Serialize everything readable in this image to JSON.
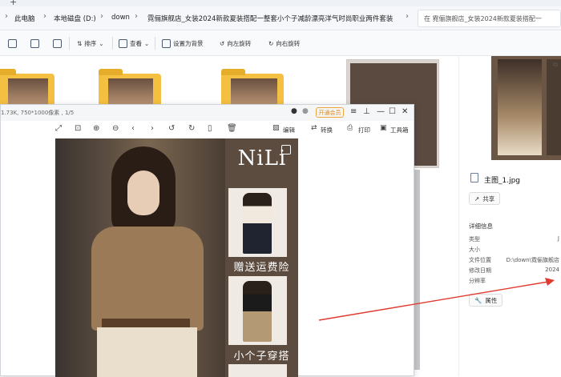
{
  "titlebar": {
    "new_tab": "+"
  },
  "breadcrumb": [
    "此电脑",
    "本地磁盘 (D:)",
    "down",
    "霓俪旗舰店_女装2024新款夏装搭配一整套小个子减龄漂亮洋气时尚职业两件套装"
  ],
  "search": {
    "placeholder": "在 霓俪旗舰店_女装2024新款夏装搭配一"
  },
  "toolbar": {
    "sort": "排序",
    "view": "查看",
    "set_wallpaper": "设置为背景",
    "rotate_left": "向左旋转",
    "rotate_right": "向右旋转"
  },
  "details": {
    "filename": "主图_1.jpg",
    "share": "共享",
    "section": "详细信息",
    "rows": [
      {
        "key": "类型",
        "value": "J"
      },
      {
        "key": "大小",
        "value": ""
      },
      {
        "key": "文件位置",
        "value": "D:\\down\\霓俪旗舰店"
      },
      {
        "key": "修改日期",
        "value": "2024"
      },
      {
        "key": "分辨率",
        "value": ""
      }
    ],
    "properties": "属性"
  },
  "viewer": {
    "info": "1.73K, 750*1000像素 , 1/5",
    "vip": "开通会员",
    "edit": "编辑",
    "convert": "转换",
    "print": "打印",
    "toolbox": "工具箱"
  },
  "image": {
    "brand": "NiLi",
    "caption1": "赠送运费险",
    "caption2": "小个子穿搭"
  },
  "colors": {
    "arrow": "#e03a2e",
    "vip": "#e0881a",
    "folder": "#f4c042"
  }
}
